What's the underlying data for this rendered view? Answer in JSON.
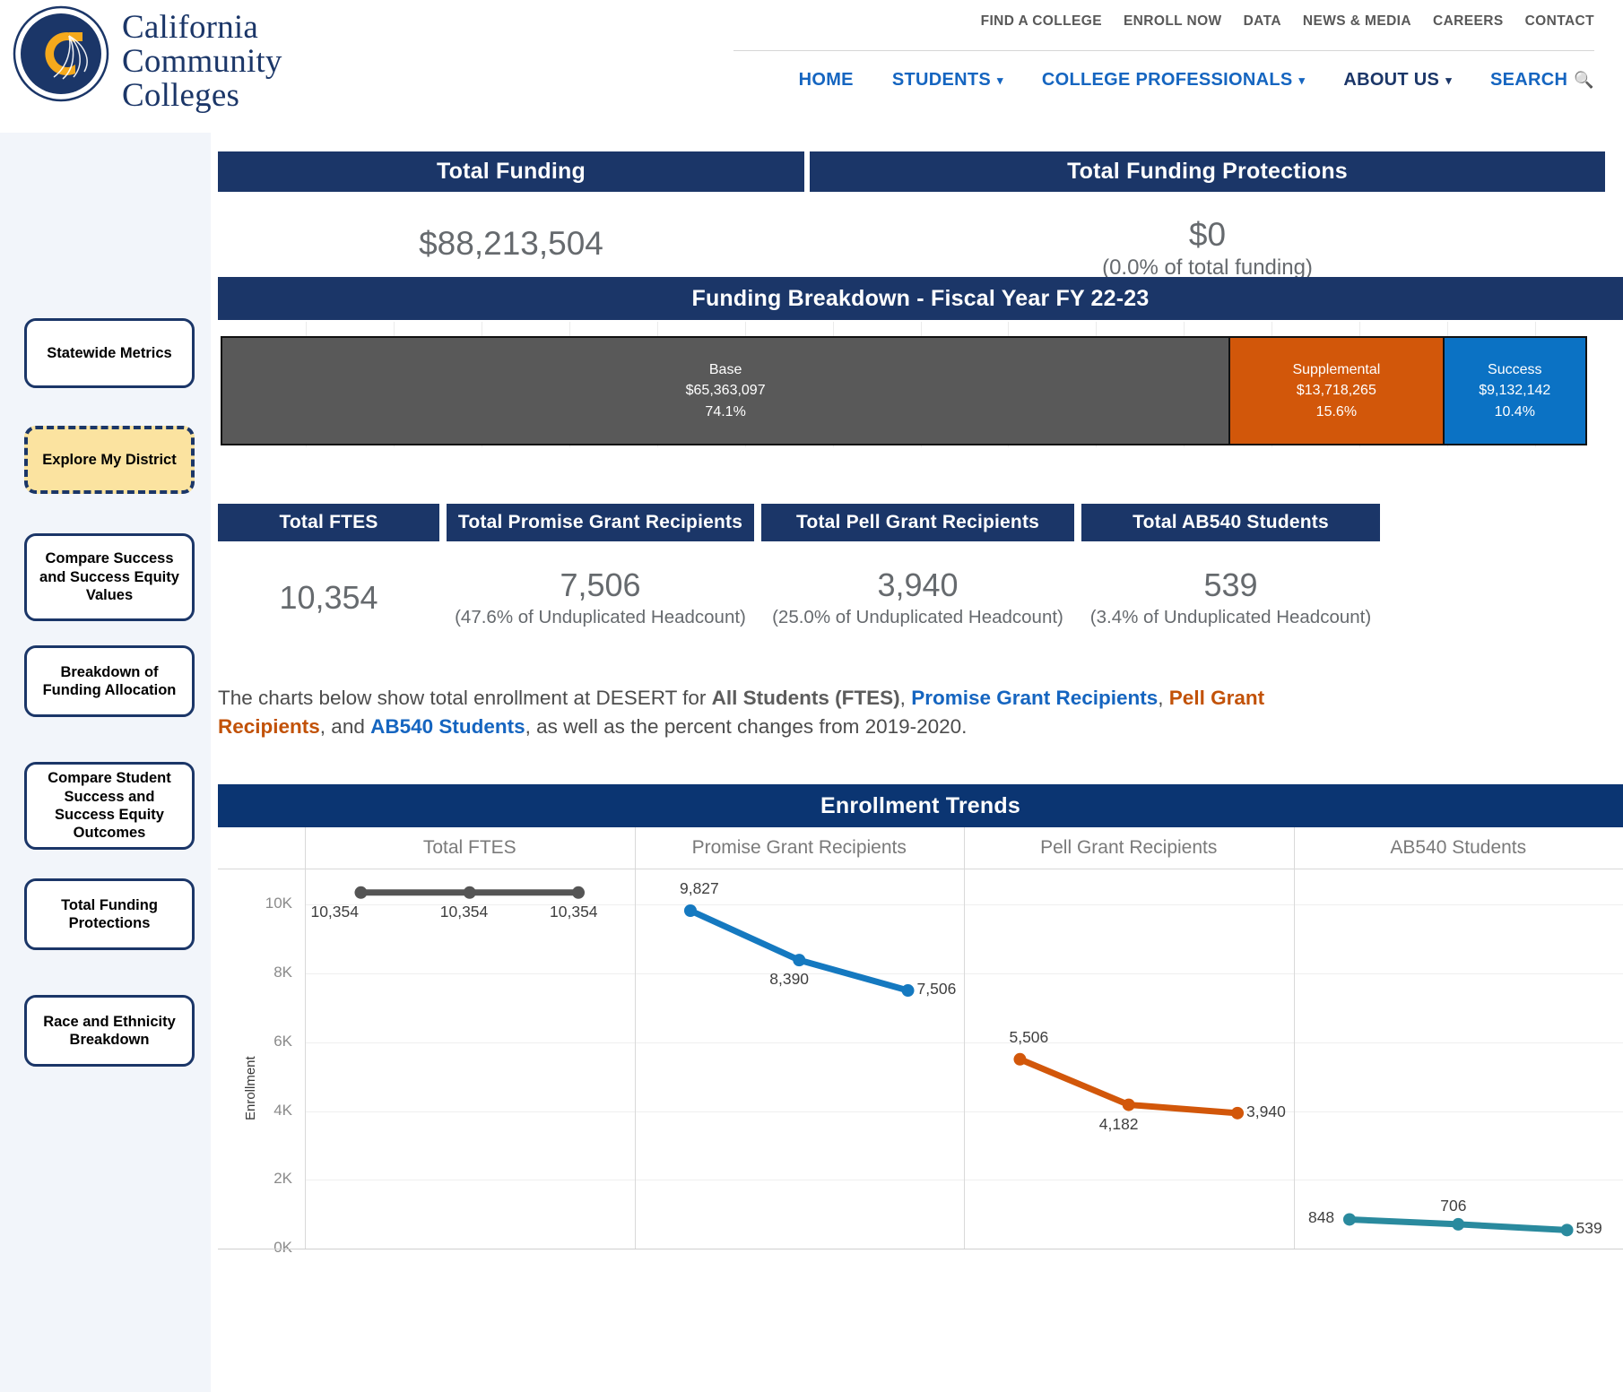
{
  "header": {
    "logo_line1": "California",
    "logo_line2": "Community",
    "logo_line3": "Colleges",
    "utility_nav": [
      "FIND A COLLEGE",
      "ENROLL NOW",
      "DATA",
      "NEWS & MEDIA",
      "CAREERS",
      "CONTACT"
    ],
    "main_nav": [
      {
        "label": "HOME",
        "caret": false,
        "dark": false
      },
      {
        "label": "STUDENTS",
        "caret": true,
        "dark": false
      },
      {
        "label": "COLLEGE PROFESSIONALS",
        "caret": true,
        "dark": false
      },
      {
        "label": "ABOUT US",
        "caret": true,
        "dark": true
      },
      {
        "label": "SEARCH",
        "caret": false,
        "dark": false
      }
    ],
    "search_icon": "search-icon",
    "caret_glyph": "⌄"
  },
  "sidebar": {
    "items": [
      {
        "label": "Statewide Metrics",
        "active": false
      },
      {
        "label": "Explore My District",
        "active": true
      },
      {
        "label": "Compare Success and Success Equity Values",
        "active": false
      },
      {
        "label": "Breakdown of Funding Allocation",
        "active": false
      },
      {
        "label": "Compare Student Success and Success Equity Outcomes",
        "active": false
      },
      {
        "label": "Total Funding Protections",
        "active": false
      },
      {
        "label": "Race and Ethnicity Breakdown",
        "active": false
      }
    ]
  },
  "top_kpis": [
    {
      "title": "Total Funding",
      "value": "$88,213,504",
      "sub": ""
    },
    {
      "title": "Total Funding Protections",
      "value": "$0",
      "sub": "(0.0% of total funding)"
    }
  ],
  "funding_breakdown": {
    "title": "Funding Breakdown - Fiscal Year FY 22-23",
    "segments": [
      {
        "name": "Base",
        "amount": "$65,363,097",
        "percent": "74.1%",
        "pct_num": 74.1,
        "color": "#595959"
      },
      {
        "name": "Supplemental",
        "amount": "$13,718,265",
        "percent": "15.6%",
        "pct_num": 15.6,
        "color": "#d2570a"
      },
      {
        "name": "Success",
        "amount": "$9,132,142",
        "percent": "10.4%",
        "pct_num": 10.4,
        "color": "#0b72c4"
      }
    ]
  },
  "metric_kpis": [
    {
      "title": "Total FTES",
      "value": "10,354",
      "sub": ""
    },
    {
      "title": "Total Promise Grant Recipients",
      "value": "7,506",
      "sub": "(47.6% of Unduplicated Headcount)"
    },
    {
      "title": "Total Pell Grant Recipients",
      "value": "3,940",
      "sub": "(25.0% of Unduplicated Headcount)"
    },
    {
      "title": "Total AB540 Students",
      "value": "539",
      "sub": "(3.4% of Unduplicated Headcount)"
    }
  ],
  "description": {
    "p1": "The charts below show total enrollment at DESERT for ",
    "s1": "All Students (FTES)",
    "p2": ", ",
    "s2": "Promise Grant Recipients",
    "p3": ", ",
    "s3": "Pell Grant Recipients",
    "p4": ", and ",
    "s4": "AB540 Students",
    "p5": ", as well as the percent changes from 2019-2020."
  },
  "chart_data": {
    "type": "line",
    "title": "Enrollment Trends",
    "ylabel": "Enrollment",
    "xlabel": "",
    "ylim": [
      0,
      11000
    ],
    "yticks": [
      "0K",
      "2K",
      "4K",
      "6K",
      "8K",
      "10K"
    ],
    "ytick_values": [
      0,
      2000,
      4000,
      6000,
      8000,
      10000
    ],
    "grid": true,
    "legend": "none",
    "x": [
      1,
      2,
      3
    ],
    "panels": [
      {
        "name": "Total FTES",
        "color": "#555555",
        "values": [
          10354,
          10354,
          10354
        ],
        "labels": [
          "10,354",
          "10,354",
          "10,354"
        ],
        "label_pos": [
          "below-left",
          "below",
          "below-right"
        ]
      },
      {
        "name": "Promise Grant Recipients",
        "color": "#1579c0",
        "values": [
          9827,
          8390,
          7506
        ],
        "labels": [
          "9,827",
          "8,390",
          "7,506"
        ],
        "label_pos": [
          "above-left",
          "below",
          "right"
        ]
      },
      {
        "name": "Pell Grant Recipients",
        "color": "#d2570a",
        "values": [
          5506,
          4182,
          3940
        ],
        "labels": [
          "5,506",
          "4,182",
          "3,940"
        ],
        "label_pos": [
          "above-left",
          "below",
          "right"
        ]
      },
      {
        "name": "AB540 Students",
        "color": "#2a8a9e",
        "values": [
          848,
          706,
          539
        ],
        "labels": [
          "848",
          "706",
          "539"
        ],
        "label_pos": [
          "left",
          "above",
          "right"
        ]
      }
    ]
  }
}
